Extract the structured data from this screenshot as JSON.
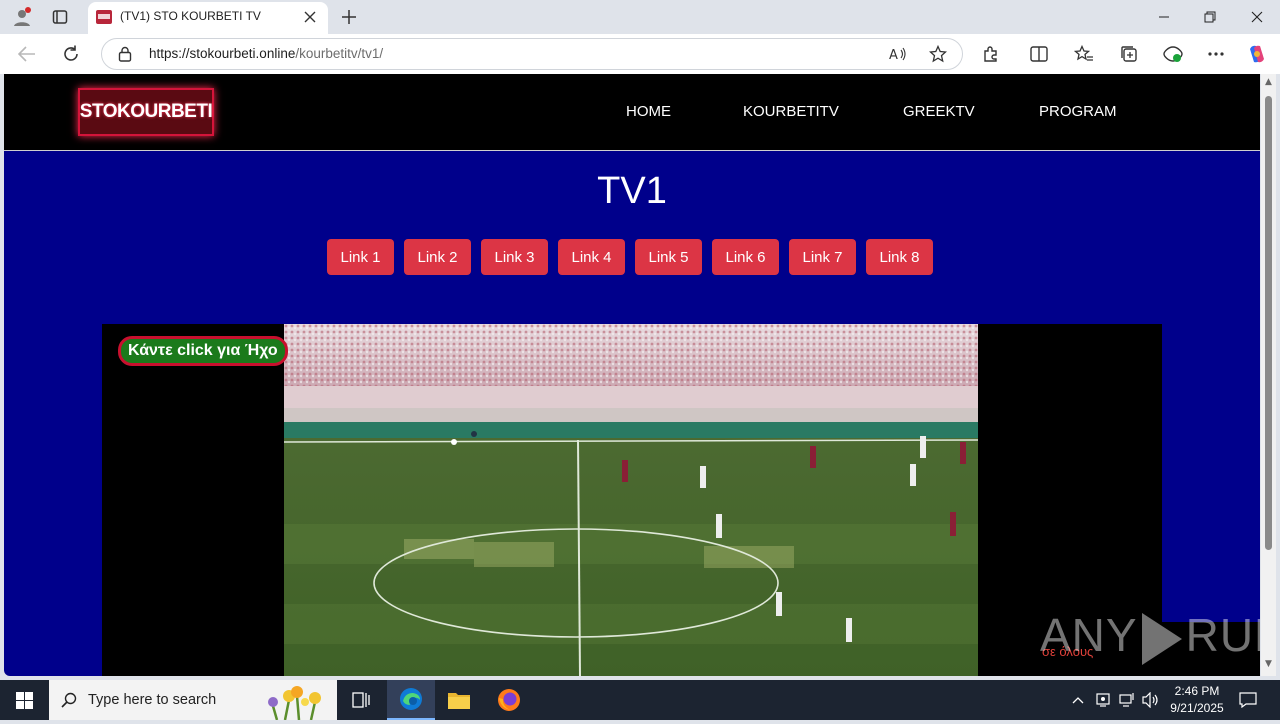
{
  "browser": {
    "tab_title": "(TV1) STO KOURBETI TV",
    "url_host": "https://stokourbeti.online",
    "url_path": "/kourbetitv/tv1/"
  },
  "site": {
    "logo_text": "STOKOURBETI",
    "nav": [
      "HOME",
      "KOURBETITV",
      "GREEKTV",
      "PROGRAM"
    ],
    "page_title": "TV1",
    "links": [
      "Link 1",
      "Link 2",
      "Link 3",
      "Link 4",
      "Link 5",
      "Link 6",
      "Link 7",
      "Link 8"
    ],
    "sound_button": "Κάντε click για Ήχο",
    "overlay_small_text": "σε όλους"
  },
  "watermark": {
    "left": "ANY",
    "right": "RUN"
  },
  "taskbar": {
    "search_placeholder": "Type here to search",
    "time": "2:46 PM",
    "date": "9/21/2025"
  },
  "colors": {
    "page_bg": "#00008b",
    "link_button": "#dc3545",
    "header_bg": "#000000",
    "sound_button_bg": "#1b7a1b",
    "sound_button_border": "#c8102e"
  }
}
